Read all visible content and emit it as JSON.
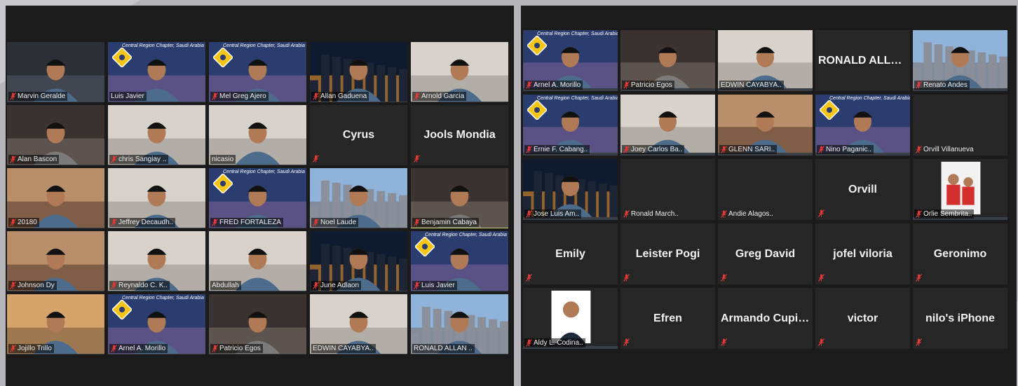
{
  "left_panel": {
    "tiles": [
      {
        "name": "Marvin Geralde",
        "video": true,
        "scene": "person-dark",
        "muted": true
      },
      {
        "name": "Luis Javier",
        "video": true,
        "scene": "chapter-bg",
        "muted": false
      },
      {
        "name": "Mel Greg Ajero",
        "video": true,
        "scene": "chapter-bg",
        "muted": true
      },
      {
        "name": "Allan Gaduena",
        "video": true,
        "scene": "city-night",
        "muted": true
      },
      {
        "name": "Arnold Garcia",
        "video": true,
        "scene": "light-room",
        "muted": true
      },
      {
        "name": "Alan Bascon",
        "video": true,
        "scene": "dark-room",
        "muted": true
      },
      {
        "name": "chris Sangiay ..",
        "video": true,
        "scene": "light-room",
        "muted": true
      },
      {
        "name": "nicasio",
        "video": true,
        "scene": "light-room",
        "muted": false
      },
      {
        "name": "Cyrus",
        "video": false,
        "muted": true
      },
      {
        "name": "Jools Mondia",
        "video": false,
        "muted": true
      },
      {
        "name": "20180",
        "video": true,
        "scene": "warm-room",
        "muted": true
      },
      {
        "name": "Jeffrey Decaudh..",
        "video": true,
        "scene": "light-room",
        "muted": true
      },
      {
        "name": "FRED FORTALEZA",
        "video": true,
        "scene": "chapter-bg",
        "muted": true
      },
      {
        "name": "Noel Laude",
        "video": true,
        "scene": "city-day",
        "muted": true
      },
      {
        "name": "Benjamin Cabaya",
        "video": true,
        "scene": "dark-room",
        "muted": true,
        "active": true
      },
      {
        "name": "Johnson Dy",
        "video": true,
        "scene": "warm-room",
        "muted": true
      },
      {
        "name": "Reynaldo C. K..",
        "video": true,
        "scene": "light-room",
        "muted": true
      },
      {
        "name": "Abdullah",
        "video": true,
        "scene": "light-room",
        "muted": false
      },
      {
        "name": "June Adlaon",
        "video": true,
        "scene": "city-night",
        "muted": true
      },
      {
        "name": "Luis Javier",
        "video": true,
        "scene": "chapter-bg",
        "muted": true
      },
      {
        "name": "Jojillo Trillo",
        "video": true,
        "scene": "desert",
        "muted": true
      },
      {
        "name": "Arnel A. Morillo",
        "video": true,
        "scene": "chapter-bg",
        "muted": true
      },
      {
        "name": "Patricio Egos",
        "video": true,
        "scene": "dark-room",
        "muted": true
      },
      {
        "name": "EDWIN CAYABYA..",
        "video": true,
        "scene": "light-room",
        "muted": false
      },
      {
        "name": "RONALD ALLAN ..",
        "video": true,
        "scene": "city-day",
        "muted": false
      }
    ]
  },
  "right_panel": {
    "tiles": [
      {
        "name": "Arnel A. Morillo",
        "video": true,
        "scene": "chapter-bg",
        "muted": true
      },
      {
        "name": "Patricio Egos",
        "video": true,
        "scene": "dark-room",
        "muted": true
      },
      {
        "name": "EDWIN CAYABYA..",
        "video": true,
        "scene": "light-room",
        "muted": false
      },
      {
        "name": "RONALD ALLA...",
        "video": false,
        "muted": false
      },
      {
        "name": "Renato Andes",
        "video": true,
        "scene": "city-day",
        "muted": true
      },
      {
        "name": "Ernie F. Cabang..",
        "video": true,
        "scene": "chapter-bg",
        "muted": true
      },
      {
        "name": "Joey Carlos Ba..",
        "video": true,
        "scene": "light-room",
        "muted": true
      },
      {
        "name": "GLENN SARI..",
        "video": true,
        "scene": "warm-room",
        "muted": true
      },
      {
        "name": "Nino Paganic..",
        "video": true,
        "scene": "chapter-bg",
        "muted": true
      },
      {
        "name": "Orvill Villanueva",
        "video": false,
        "muted": true,
        "bottom_only": true
      },
      {
        "name": "Jose Luis Am..",
        "video": true,
        "scene": "city-night",
        "muted": true
      },
      {
        "name": "Ronald March..",
        "video": false,
        "muted": true,
        "bottom_only": true
      },
      {
        "name": "Andie Alagos..",
        "video": false,
        "muted": true,
        "bottom_only": true
      },
      {
        "name": "Orvill",
        "video": false,
        "muted": true
      },
      {
        "name": "Orlie Sembrita..",
        "video": true,
        "scene": "photo-group",
        "muted": true
      },
      {
        "name": "Emily",
        "video": false,
        "muted": true
      },
      {
        "name": "Leister Pogi",
        "video": false,
        "muted": true
      },
      {
        "name": "Greg David",
        "video": false,
        "muted": true
      },
      {
        "name": "jofel viloria",
        "video": false,
        "muted": true
      },
      {
        "name": "Geronimo",
        "video": false,
        "muted": true
      },
      {
        "name": "Aldy L. Codina..",
        "video": true,
        "scene": "photo-portrait",
        "muted": true
      },
      {
        "name": "Efren",
        "video": false,
        "muted": true
      },
      {
        "name": "Armando  Cupin...",
        "video": false,
        "muted": true
      },
      {
        "name": "victor",
        "video": false,
        "muted": true
      },
      {
        "name": "nilo's iPhone",
        "video": false,
        "muted": true
      }
    ]
  },
  "chapter_caption": "Central Region Chapter, Saudi Arabia",
  "colors": {
    "mute_red": "#e53935",
    "active_border": "#c9d46a",
    "tile_bg": "#262627"
  }
}
